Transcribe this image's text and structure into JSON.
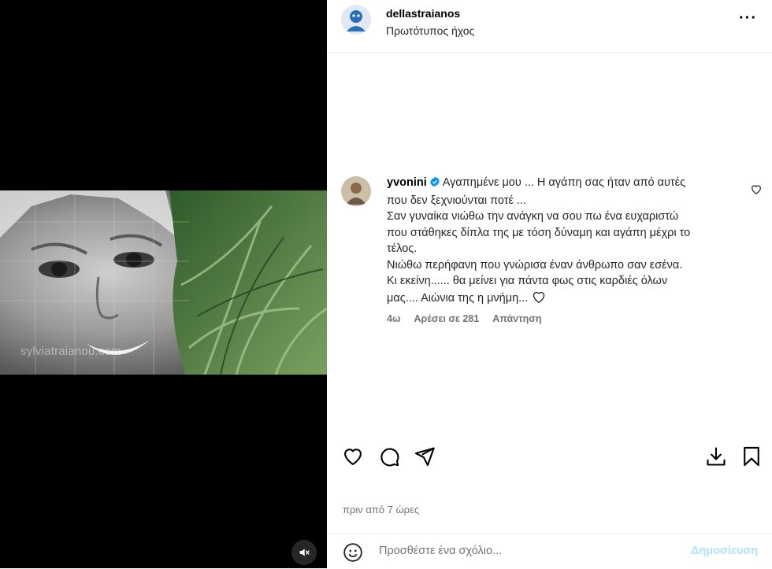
{
  "media": {
    "watermark": "sylviatraianou.com"
  },
  "header": {
    "username": "dellastraianos",
    "audio": "Πρωτότυπος ήχος",
    "more": "···"
  },
  "comment": {
    "username": "yvonini",
    "lines": [
      "Αγαπημένε μου ... Η αγάπη σας ήταν από αυτές",
      "που δεν ξεχνιούνται ποτέ ...",
      "Σαν γυναίκα νιώθω την ανάγκη να σου πω ένα ευχαριστώ",
      "που στάθηκες δίπλα της με τόση δύναμη και αγάπη μέχρι το",
      "τέλος.",
      "Νιώθω περήφανη που γνώρισα έναν άνθρωπο σαν εσένα.",
      "Κι εκείνη...... θα μείνει για πάντα φως στις καρδιές όλων",
      "μας.... Αιώνια της η μνήμη..."
    ],
    "age": "4ω",
    "likes": "Αρέσει σε 281",
    "reply": "Απάντηση"
  },
  "post": {
    "time": "πριν από 7 ώρες"
  },
  "composer": {
    "placeholder": "Προσθέστε ένα σχόλιο...",
    "submit": "Δημοσίευση"
  }
}
